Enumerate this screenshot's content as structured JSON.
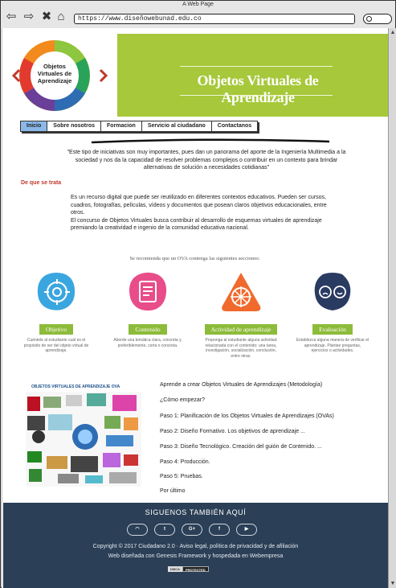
{
  "window": {
    "title": "A Web Page"
  },
  "toolbar": {
    "url": "https://www.diseñowebunad.edu.co"
  },
  "header": {
    "banner_title": "Objetos Virtuales de Aprendizaje",
    "logo_text": "Objetos Virtuales de Aprendizaje"
  },
  "nav": {
    "items": [
      "Inicio",
      "Sobre nosotros",
      "Formacion",
      "Servicio al ciudadano",
      "Contactanos"
    ]
  },
  "quote": "\"Este tipo de iniciativas son muy importantes, pues dan un panorama del aporte de la Ingeniería Multimedia a la sociedad y nos da la capacidad de resolver problemas complejos o contribuir en un contexto para brindar alternativas de solución a necesidades cotidianas\"",
  "section": {
    "label": "De que se trata"
  },
  "description": {
    "p1": "Es un recurso digital que puede ser reutilizado en diferentes contextos educativos. Pueden ser cursos, cuadros, fotografías, películas, vídeos y documentos que posean claros objetivos educacionales, entre otros.",
    "p2": "El concurso de Objetos Virtuales busca contribuir al desarrollo de esquemas virtuales de aprendizaje premiando la creatividad e ingenio de la comunidad educativa nacional."
  },
  "recommend": "Se recomienda que un OVA contenga las siguientes secciones:",
  "cards": [
    {
      "title": "Objetivo",
      "text": "Cuéntele al estudiante cuál es el propósito de ser del objeto virtual de aprendizaje.",
      "color": "#3aa6e0",
      "icon": "target-icon"
    },
    {
      "title": "Contenido",
      "text": "Aborde una temática clara, concreta y, preferiblemente, corta o concreta.",
      "color": "#e84d8a",
      "icon": "document-icon"
    },
    {
      "title": "Actividad de aprendizaje",
      "text": "Proponga al estudiante alguna actividad relacionada con el contenido: una tarea, investigación, socialización, conclusión, entre otras.",
      "color": "#f06a2e",
      "icon": "compass-icon"
    },
    {
      "title": "Evaluación",
      "text": "Establezca alguna manera de verificar el aprendizaje. Plantee preguntas, ejercicios o actividades.",
      "color": "#2a3b62",
      "icon": "faces-icon"
    }
  ],
  "ova": {
    "title": "OBJETOS VIRTUALES DE APRENDIZAJE OVA"
  },
  "steps": [
    "Aprende a crear Objetos Virtuales de Aprendizajes (Metodología)",
    "¿Cómo empezar?",
    "Paso 1: Planificación de los Objetos Virtuales de Aprendizajes (OVAs)",
    "Paso 2: Diseño Formativo. Los objetivos de aprendizaje ...",
    "Paso 3: Diseño Tecnológico. Creación del guión de Contenido. ...",
    "Paso 4: Producción.",
    "Paso 5: Pruebas.",
    "Por último"
  ],
  "footer": {
    "title": "SIGUENOS TAMBIÉN AQUÍ",
    "socials": [
      "rss-icon",
      "twitter-icon",
      "google-plus-icon",
      "facebook-icon",
      "youtube-icon"
    ],
    "copyright": "Copyright © 2017 Ciudadano 2.0 · Aviso legal, política de privacidad y de afiliación",
    "web": "Web diseñada con Genesis Framework y hospedada en Webempresa",
    "dmca_a": "DMCA",
    "dmca_b": "PROTECTED"
  },
  "colors": {
    "banner": "#a6c83a",
    "footer": "#2b3f56",
    "nav_active": "#8bb8e8",
    "section_label": "#c0392b"
  }
}
